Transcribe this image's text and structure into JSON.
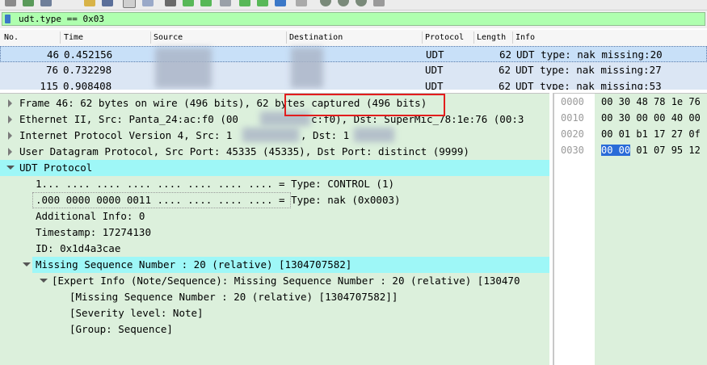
{
  "filter": {
    "text": "udt.type == 0x03"
  },
  "list": {
    "columns": [
      "No.",
      "Time",
      "Source",
      "Destination",
      "Protocol",
      "Length",
      "Info"
    ],
    "rows": [
      {
        "no": "46",
        "time": "0.452156",
        "protocol": "UDT",
        "length": "62",
        "info": "UDT type: nak missing:20",
        "selected": true
      },
      {
        "no": "76",
        "time": "0.732298",
        "protocol": "UDT",
        "length": "62",
        "info": "UDT type: nak missing:27",
        "selected": false
      },
      {
        "no": "115",
        "time": "0.908408",
        "protocol": "UDT",
        "length": "62",
        "info": "UDT type: nak missing:53",
        "selected": false
      }
    ]
  },
  "details": [
    {
      "text": "Frame 46: 62 bytes on wire (496 bits), 62 bytes captured (496 bits)",
      "level": 0,
      "expander": "closed"
    },
    {
      "text": "Ethernet II, Src: Panta_24:ac:f0 (00",
      "text2": "c:f0), Dst: SuperMic_78:1e:76 (00:3",
      "level": 0,
      "expander": "closed"
    },
    {
      "text": "Internet Protocol Version 4, Src: 1",
      "text2": ", Dst: 1",
      "level": 0,
      "expander": "closed"
    },
    {
      "text": "User Datagram Protocol, Src Port: 45335 (45335), Dst Port: distinct (9999)",
      "level": 0,
      "expander": "closed"
    },
    {
      "text": "UDT Protocol",
      "level": 0,
      "expander": "open",
      "highlight": true
    },
    {
      "text": "1... .... .... .... .... .... .... .... = Type: CONTROL (1)",
      "level": 1
    },
    {
      "text": ".000 0000 0000 0011 .... .... .... .... = Type: nak (0x0003)",
      "level": 1,
      "boxed": true
    },
    {
      "text": "Additional Info: 0",
      "level": 1
    },
    {
      "text": "Timestamp: 17274130",
      "level": 1
    },
    {
      "text": "ID: 0x1d4a3cae",
      "level": 1
    },
    {
      "text": "Missing Sequence Number : 20 (relative) [1304707582]",
      "level": 1,
      "expander": "open",
      "highlight": true
    },
    {
      "text": "[Expert Info (Note/Sequence): Missing Sequence Number : 20 (relative) [130470",
      "level": 2,
      "expander": "open"
    },
    {
      "text": "[Missing Sequence Number : 20 (relative) [1304707582]]",
      "level": 3
    },
    {
      "text": "[Severity level: Note]",
      "level": 3
    },
    {
      "text": "[Group: Sequence]",
      "level": 3
    }
  ],
  "hex": [
    {
      "offset": "0000",
      "bytes": "00 30 48 78 1e 76"
    },
    {
      "offset": "0010",
      "bytes": "00 30 00 00 40 00"
    },
    {
      "offset": "0020",
      "bytes": "00 01 b1 17 27 0f"
    },
    {
      "offset": "0030",
      "selected": "00 00",
      "bytes": "01 07 95 12"
    }
  ],
  "colors": {
    "filter_bg": "#afffaf",
    "details_bg": "#dcf0dc",
    "highlight": "#9ef7f7",
    "annotation": "#e21d1d",
    "hex_select": "#2a6bd8"
  }
}
